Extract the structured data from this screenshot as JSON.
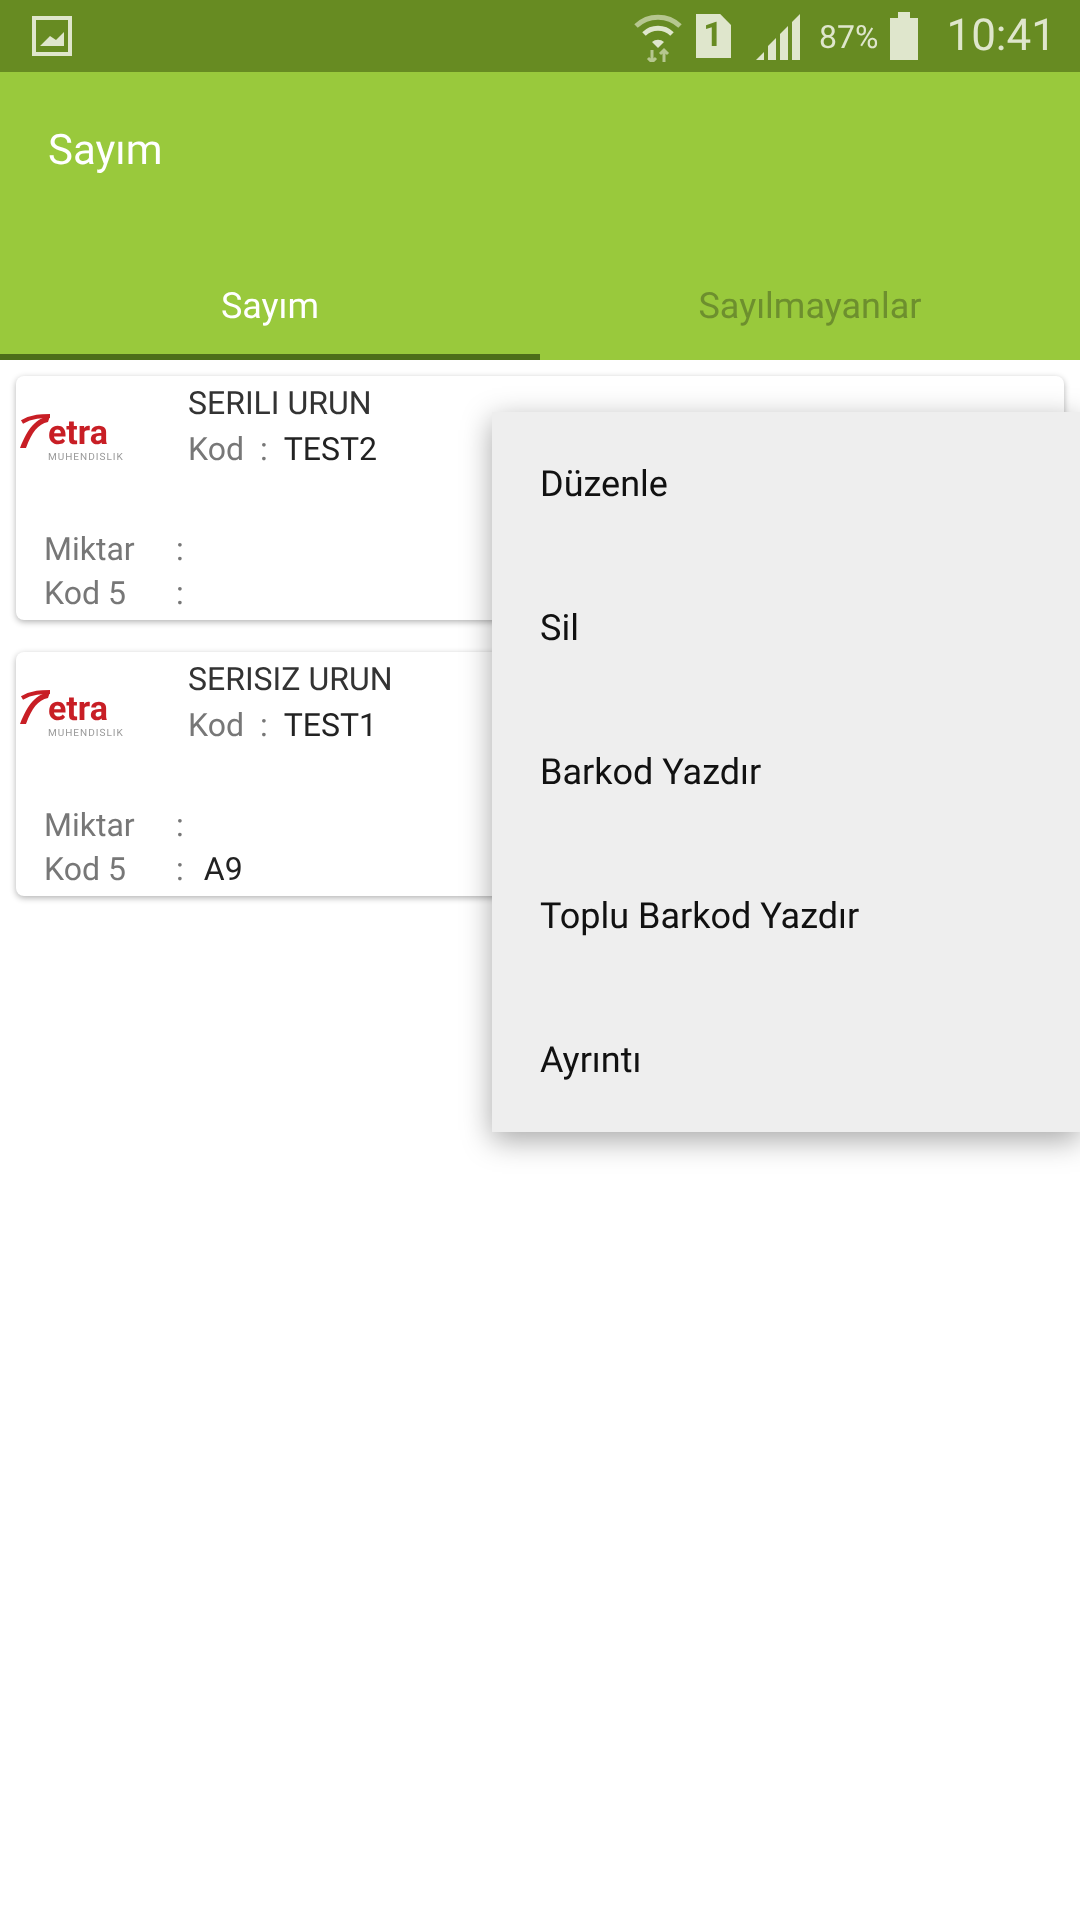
{
  "status_bar": {
    "sim_slot": "1",
    "battery": "87%",
    "time": "10:41"
  },
  "app_bar": {
    "title": "Sayım"
  },
  "tabs": [
    {
      "label": "Sayım",
      "selected": true
    },
    {
      "label": "Sayılmayanlar",
      "selected": false
    }
  ],
  "items": [
    {
      "logo_text": "etra",
      "logo_subtext": "MUHENDISLIK",
      "name": "SERILI URUN",
      "code": {
        "label": "Kod",
        "sep": ":",
        "value": "TEST2"
      },
      "fields": [
        {
          "label": "Miktar",
          "sep": ":"
        },
        {
          "label": "Kod 5",
          "sep": ":"
        }
      ]
    },
    {
      "logo_text": "etra",
      "logo_subtext": "MUHENDISLIK",
      "name": "SERISIZ URUN",
      "code": {
        "label": "Kod",
        "sep": ":",
        "value": "TEST1"
      },
      "fields": [
        {
          "label": "Miktar",
          "sep": ":"
        },
        {
          "label": "Kod 5",
          "sep": ":",
          "value": "A9"
        }
      ]
    }
  ],
  "menu": {
    "items": [
      "Düzenle",
      "Sil",
      "Barkod Yazdır",
      "Toplu Barkod Yazdır",
      "Ayrıntı"
    ]
  }
}
